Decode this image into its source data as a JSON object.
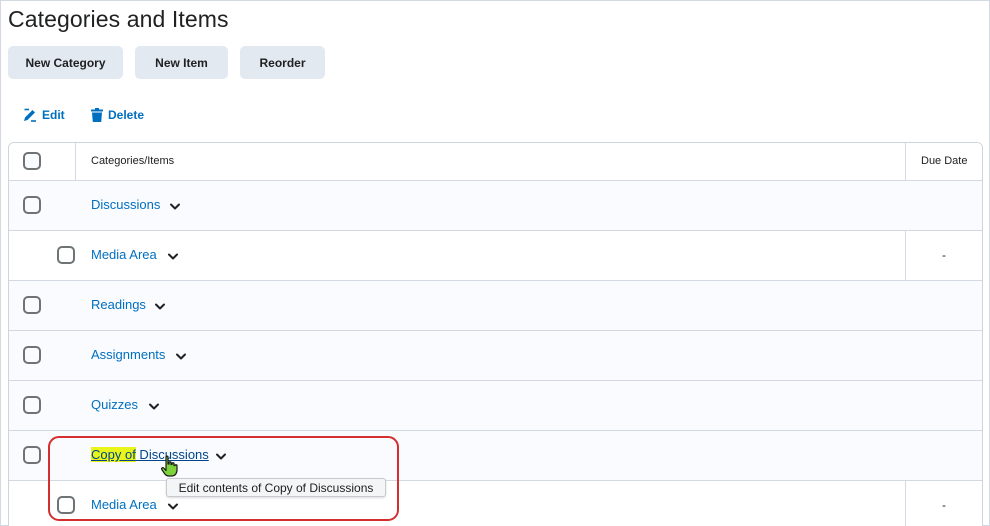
{
  "page": {
    "title": "Categories and Items"
  },
  "toolbar": {
    "new_category": "New Category",
    "new_item": "New Item",
    "reorder": "Reorder"
  },
  "actions": {
    "edit": "Edit",
    "delete": "Delete"
  },
  "table": {
    "header": {
      "name": "Categories/Items",
      "due": "Due Date"
    },
    "rows": [
      {
        "type": "category",
        "name": "Discussions"
      },
      {
        "type": "item",
        "name": "Media Area",
        "due": "-"
      },
      {
        "type": "category",
        "name": "Readings"
      },
      {
        "type": "category",
        "name": "Assignments"
      },
      {
        "type": "category",
        "name": "Quizzes"
      },
      {
        "type": "category",
        "name_highlight": "Copy of",
        "name_rest": " Discussions"
      },
      {
        "type": "item",
        "name": "Media Area",
        "due": "-"
      }
    ]
  },
  "tooltip": {
    "text": "Edit contents of Copy of Discussions"
  },
  "colors": {
    "link": "#006fbf",
    "button_bg": "#e3e9f1",
    "highlight": "#e9f51a",
    "callout": "#d32f2f"
  },
  "icons": [
    "edit-icon",
    "delete-icon",
    "chevron-down-icon",
    "hand-cursor-icon"
  ]
}
